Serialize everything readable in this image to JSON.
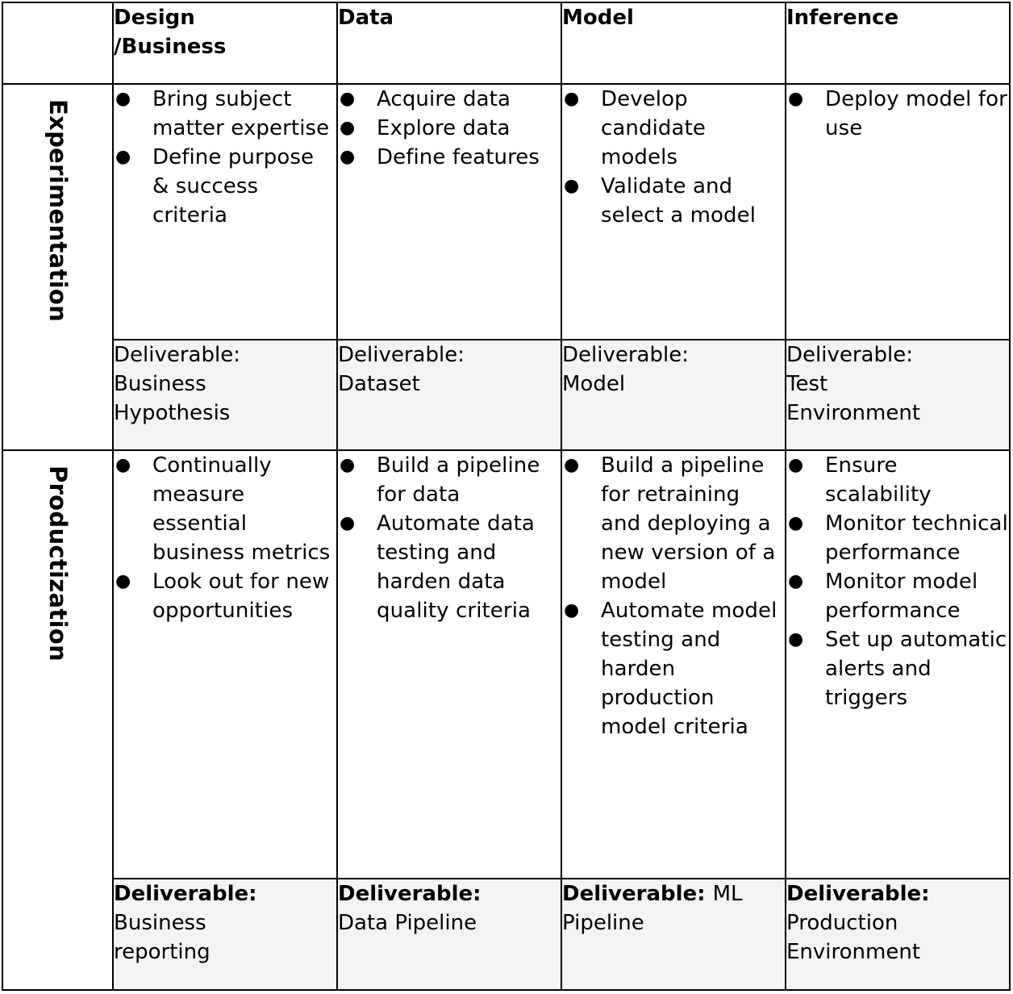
{
  "columns": [
    "",
    "Design\n/Business",
    "Data",
    "Model",
    "Inference"
  ],
  "column_headers": {
    "design_line1": "Design",
    "design_line2": "/Business",
    "data": "Data",
    "model": "Model",
    "inference": "Inference"
  },
  "rows": {
    "experimentation": {
      "label": "Experimentation",
      "cells": {
        "design": [
          "Bring subject matter expertise",
          "Define purpose & success criteria"
        ],
        "data": [
          "Acquire data",
          "Explore data",
          "Define features"
        ],
        "model": [
          "Develop candidate models",
          "Validate and select a model"
        ],
        "inference": [
          "Deploy model for use"
        ]
      },
      "deliverables": {
        "design": {
          "label": "Deliverable:",
          "value": "Business Hypothesis"
        },
        "data": {
          "label": "Deliverable:",
          "value": "Dataset"
        },
        "model": {
          "label": "Deliverable:",
          "value": "Model"
        },
        "inference": {
          "label": "Deliverable:",
          "value": "Test Environment"
        }
      }
    },
    "productization": {
      "label": "Productization",
      "cells": {
        "design": [
          "Continually measure essential business metrics",
          "Look out for new opportunities"
        ],
        "data": [
          "Build a pipeline for data",
          "Automate data testing and harden data quality criteria"
        ],
        "model": [
          "Build a pipeline for retraining and deploying a new version of a model",
          "Automate model testing and harden production model criteria"
        ],
        "inference": [
          "Ensure scalability",
          "Monitor technical performance",
          "Monitor model performance",
          "Set up automatic alerts and triggers"
        ]
      },
      "deliverables": {
        "design": {
          "label": "Deliverable:",
          "value": "Business reporting"
        },
        "data": {
          "label": "Deliverable:",
          "value": "Data Pipeline"
        },
        "model": {
          "label": "Deliverable:",
          "value": "ML Pipeline"
        },
        "inference": {
          "label": "Deliverable:",
          "value": "Production Environment"
        }
      }
    }
  },
  "bullet_glyph": "●",
  "colors": {
    "border": "#000000",
    "deliverable_bg": "#f3f3f3",
    "text": "#000000"
  }
}
